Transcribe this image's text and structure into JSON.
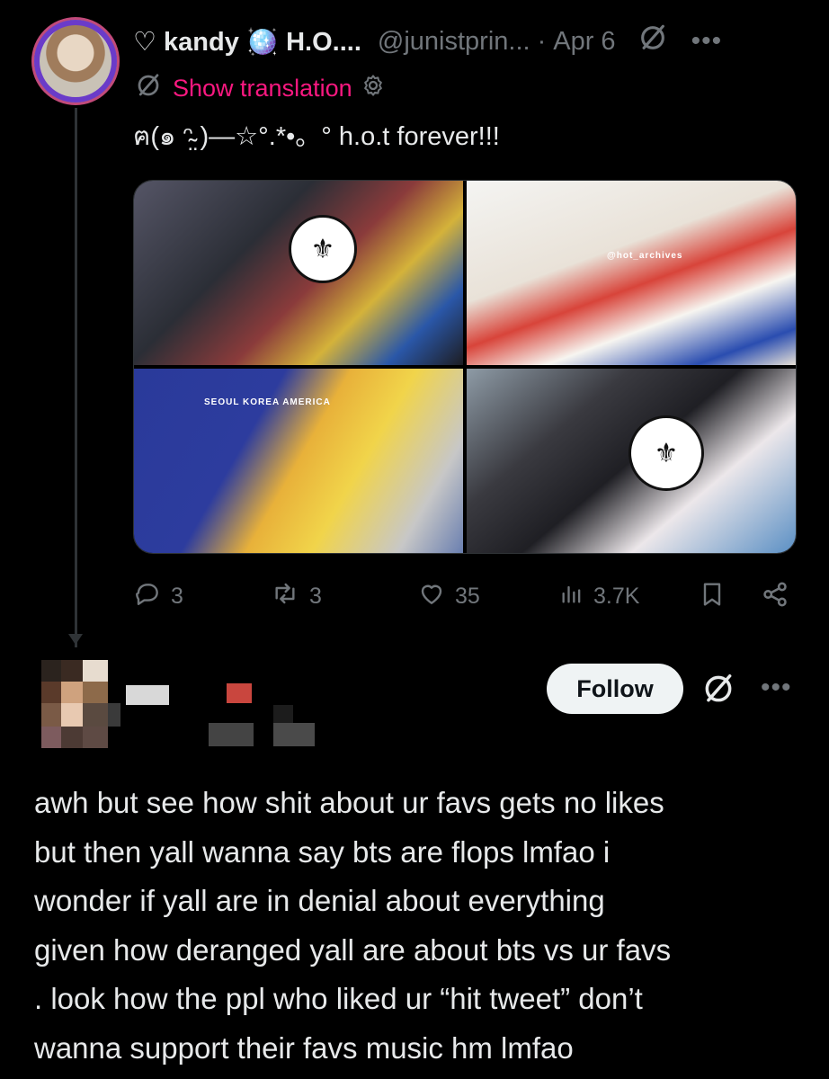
{
  "quoted_tweet": {
    "display_name": "♡ kandy 🪩 H.O....",
    "handle": "@junistprin...",
    "separator": "·",
    "date": "Apr 6",
    "show_translation": "Show translation",
    "text": "ฅ(๑ ᵔ̴̤ )—☆°.*•。° h.o.t forever!!!",
    "media_tile_captions": [
      "@hot_archives",
      "SEOUL KOREA AMERICA"
    ],
    "stats": {
      "replies": "3",
      "reposts": "3",
      "likes": "35",
      "views": "3.7K"
    }
  },
  "reply_tweet": {
    "follow_label": "Follow",
    "lines": [
      "awh but see how shit about ur favs gets no likes",
      "but then yall wanna say bts are flops lmfao i",
      "wonder if yall are in denial about everything",
      "given how deranged yall are about bts vs ur favs",
      ". look how the ppl who liked ur “hit tweet” don’t",
      "wanna support their favs music hm  lmfao"
    ]
  },
  "icons": {
    "more": "more-icon",
    "grok": "circle-slash-icon",
    "settings": "gear-icon",
    "reply": "reply-icon",
    "repost": "repost-icon",
    "like": "heart-icon",
    "views": "views-icon",
    "bookmark": "bookmark-icon",
    "share": "share-icon"
  },
  "colors": {
    "background": "#000000",
    "text": "#e7e9ea",
    "muted": "#71767b",
    "translation_link": "#f91880",
    "follow_button_bg": "#eff3f4"
  }
}
